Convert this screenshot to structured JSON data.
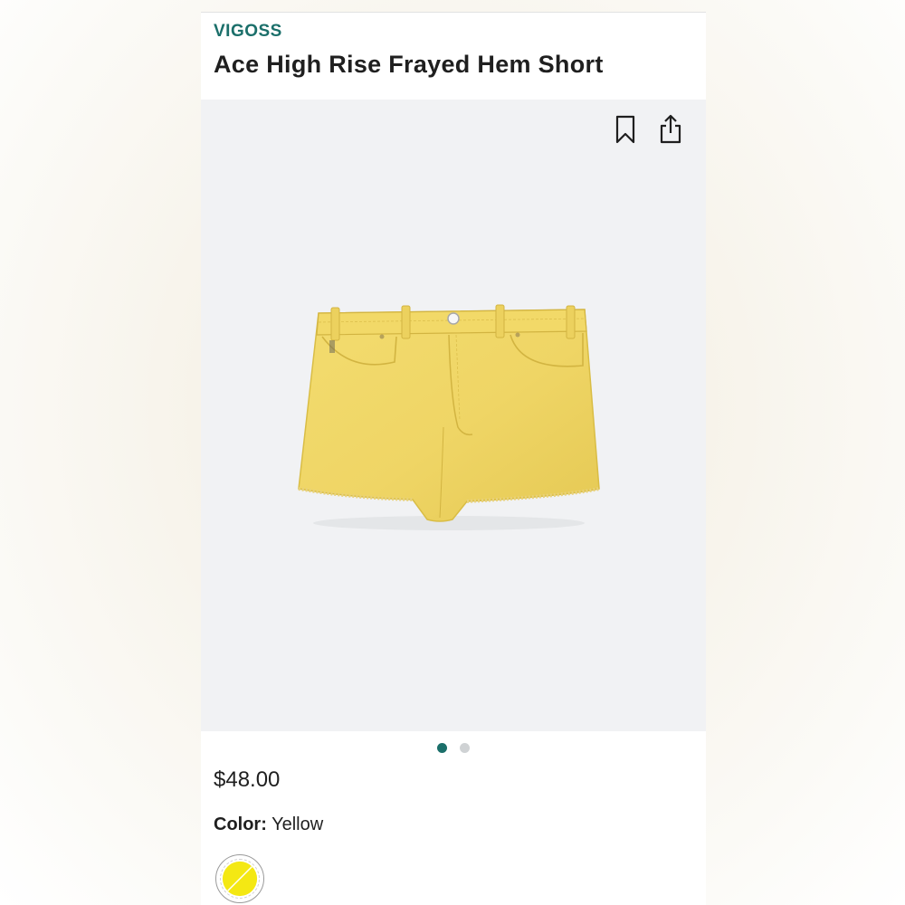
{
  "product": {
    "brand": "VIGOSS",
    "title": "Ace High Rise Frayed Hem Short",
    "image_icon": "yellow-denim-shorts",
    "price": "$48.00",
    "color_label": "Color:",
    "color_value": "Yellow",
    "swatch_color": "#f4e813"
  },
  "actions": {
    "save_icon": "bookmark-icon",
    "share_icon": "share-icon"
  },
  "gallery": {
    "total_images": 2,
    "active_index": 0
  },
  "colors": {
    "brand_accent": "#1b6f6a",
    "hero_background": "#f1f2f4",
    "shorts_fill": "#f0d86a"
  }
}
